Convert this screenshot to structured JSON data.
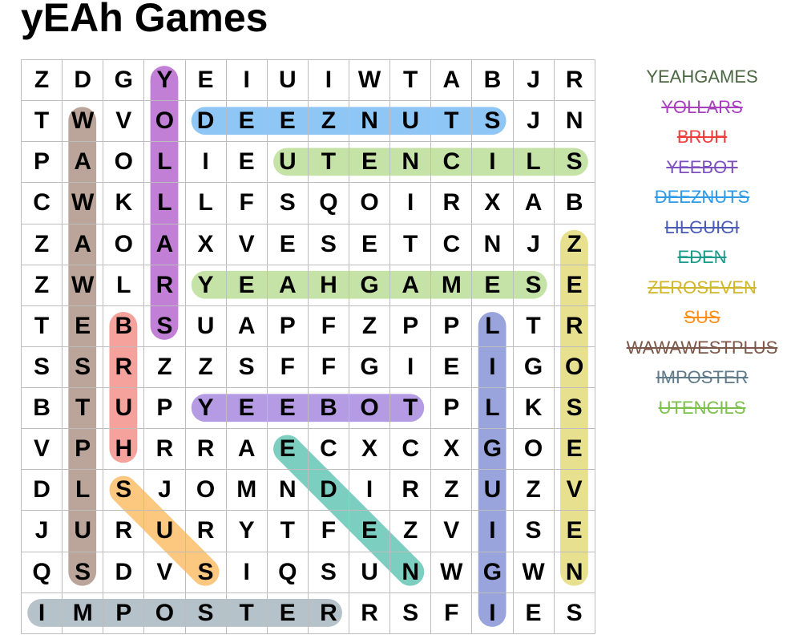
{
  "title": "yEAh Games",
  "grid": [
    "ZDGYEIUIWTABJR",
    "TWVODEEZNUTSJN",
    "PAOLIEUTENCILS",
    "CWKLLFSQOIRXAB",
    "ZAOAXVESETCNJZ",
    "ZWLRYEAHGAMESE",
    "TEBSUAPFZPPLTR",
    "SSRZZSFFGIEIGO",
    "BTUPYEEBOTPLKS",
    "VPHRRAECXCXGOE",
    "DLSJOMNDIRZUZV",
    "JURURYTFEZVISE",
    "QSDVSIQSUNWGWN",
    "IMPOSTERRSFIES"
  ],
  "words": [
    {
      "text": "YEAHGAMES",
      "found": false,
      "color": "#4a6741"
    },
    {
      "text": "YOLLARS",
      "found": true,
      "color": "#a83fbf"
    },
    {
      "text": "BRUH",
      "found": true,
      "color": "#f03c3c"
    },
    {
      "text": "YEEBOT",
      "found": true,
      "color": "#7e4fbf"
    },
    {
      "text": "DEEZNUTS",
      "found": true,
      "color": "#2f9be6"
    },
    {
      "text": "LILGUIGI",
      "found": true,
      "color": "#4a5bb5"
    },
    {
      "text": "EDEN",
      "found": true,
      "color": "#1c9a8a"
    },
    {
      "text": "ZEROSEVEN",
      "found": true,
      "color": "#d1b62b"
    },
    {
      "text": "SUS",
      "found": true,
      "color": "#ff8f1a"
    },
    {
      "text": "WAWAWESTPLUS",
      "found": true,
      "color": "#7c5848"
    },
    {
      "text": "IMPOSTER",
      "found": true,
      "color": "#5f7b8a"
    },
    {
      "text": "UTENCILS",
      "found": true,
      "color": "#7cbf4a"
    }
  ],
  "highlights": [
    {
      "word": "YOLLARS",
      "start": [
        0,
        3
      ],
      "end": [
        6,
        3
      ],
      "color": "#c17fd6"
    },
    {
      "word": "DEEZNUTS",
      "start": [
        1,
        4
      ],
      "end": [
        1,
        11
      ],
      "color": "#8ec6f5"
    },
    {
      "word": "UTENCILS",
      "start": [
        2,
        6
      ],
      "end": [
        2,
        13
      ],
      "color": "#c5e3a6"
    },
    {
      "word": "WAWAWESTPLUS",
      "start": [
        1,
        1
      ],
      "end": [
        12,
        1
      ],
      "color": "#bba49a"
    },
    {
      "word": "ZEROSEVEN",
      "start": [
        4,
        13
      ],
      "end": [
        12,
        13
      ],
      "color": "#e7e08e"
    },
    {
      "word": "YEAHGAMES",
      "start": [
        5,
        4
      ],
      "end": [
        5,
        12
      ],
      "color": "#c5e3a6"
    },
    {
      "word": "BRUH",
      "start": [
        6,
        2
      ],
      "end": [
        9,
        2
      ],
      "color": "#f5a19c"
    },
    {
      "word": "LILGUIGI",
      "start": [
        6,
        11
      ],
      "end": [
        13,
        11
      ],
      "color": "#9aa4dc"
    },
    {
      "word": "YEEBOT",
      "start": [
        8,
        4
      ],
      "end": [
        8,
        9
      ],
      "color": "#b59be3"
    },
    {
      "word": "EDEN",
      "start": [
        9,
        6
      ],
      "end": [
        12,
        9
      ],
      "color": "#7ccec0"
    },
    {
      "word": "SUS",
      "start": [
        10,
        2
      ],
      "end": [
        12,
        4
      ],
      "color": "#fcc77f"
    },
    {
      "word": "IMPOSTER",
      "start": [
        13,
        0
      ],
      "end": [
        13,
        7
      ],
      "color": "#b5c2c9"
    }
  ]
}
